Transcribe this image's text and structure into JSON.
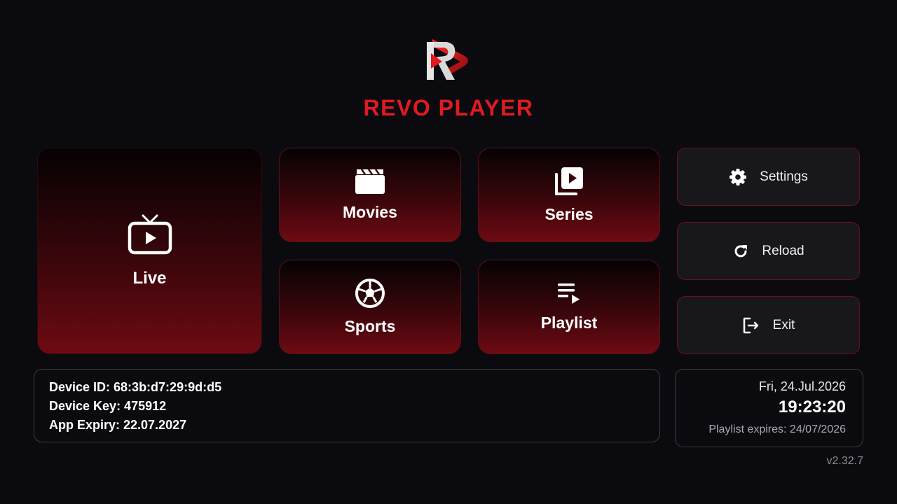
{
  "brand": {
    "name": "REVO PLAYER",
    "color": "#e01a22",
    "logo": "revo-logo-icon"
  },
  "tiles": {
    "live": {
      "label": "Live",
      "icon": "tv-icon"
    },
    "movies": {
      "label": "Movies",
      "icon": "clapperboard-icon"
    },
    "series": {
      "label": "Series",
      "icon": "video-library-icon"
    },
    "sports": {
      "label": "Sports",
      "icon": "soccer-ball-icon"
    },
    "playlist": {
      "label": "Playlist",
      "icon": "playlist-play-icon"
    }
  },
  "side": {
    "settings": {
      "label": "Settings",
      "icon": "gear-icon"
    },
    "reload": {
      "label": "Reload",
      "icon": "refresh-icon"
    },
    "exit": {
      "label": "Exit",
      "icon": "exit-icon"
    }
  },
  "device": {
    "id_line": "Device ID: 68:3b:d7:29:9d:d5",
    "key_line": "Device Key: 475912",
    "expiry_line": "App Expiry: 22.07.2027"
  },
  "clock": {
    "date": "Fri, 24.Jul.2026",
    "time": "19:23:20",
    "playlist_expiry": "Playlist expires: 24/07/2026"
  },
  "version": "v2.32.7",
  "colors": {
    "background": "#0b0b0f",
    "accent": "#e01a22",
    "tile_gradient_end": "#6e0a12",
    "panel": "#17171c"
  }
}
